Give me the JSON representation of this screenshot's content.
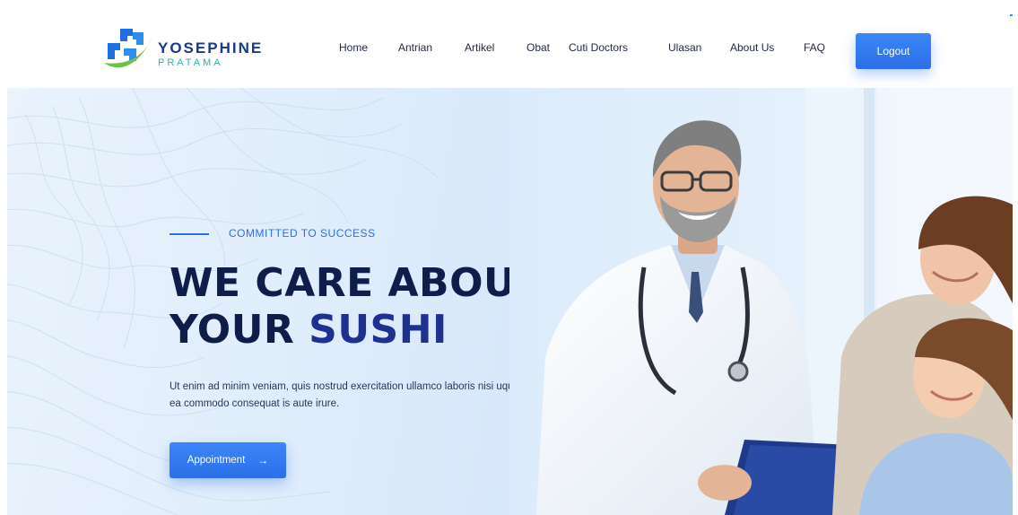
{
  "brand": {
    "name": "YOSEPHINE",
    "subname": "PRATAMA"
  },
  "nav": {
    "items": [
      {
        "label": "Home"
      },
      {
        "label": "Antrian"
      },
      {
        "label": "Artikel"
      },
      {
        "label": "Obat"
      },
      {
        "label": "Cuti Doctors"
      },
      {
        "label": "Ulasan"
      },
      {
        "label": "About Us"
      },
      {
        "label": "FAQ"
      }
    ],
    "logout_label": "Logout"
  },
  "hero": {
    "eyebrow": "COMMITTED TO SUCCESS",
    "headline_line1": "WE CARE ABOUT",
    "headline_line2_prefix": "YOUR ",
    "headline_line2_accent": "SUSHI",
    "text": "Ut enim ad minim veniam, quis nostrud exercitation ullamco laboris nisi uquip ex ea commodo consequat is aute irure.",
    "button_label": "Appointment",
    "button_arrow": "→"
  },
  "colors": {
    "accent": "#2c6fe8",
    "headline": "#0e1d4a",
    "headline_accent": "#1e3191",
    "logo_teal": "#2bb5a8",
    "logo_green": "#6cc24a"
  },
  "icons": {
    "logo": "medical-cross-logo-icon",
    "arrow": "arrow-right-icon"
  }
}
